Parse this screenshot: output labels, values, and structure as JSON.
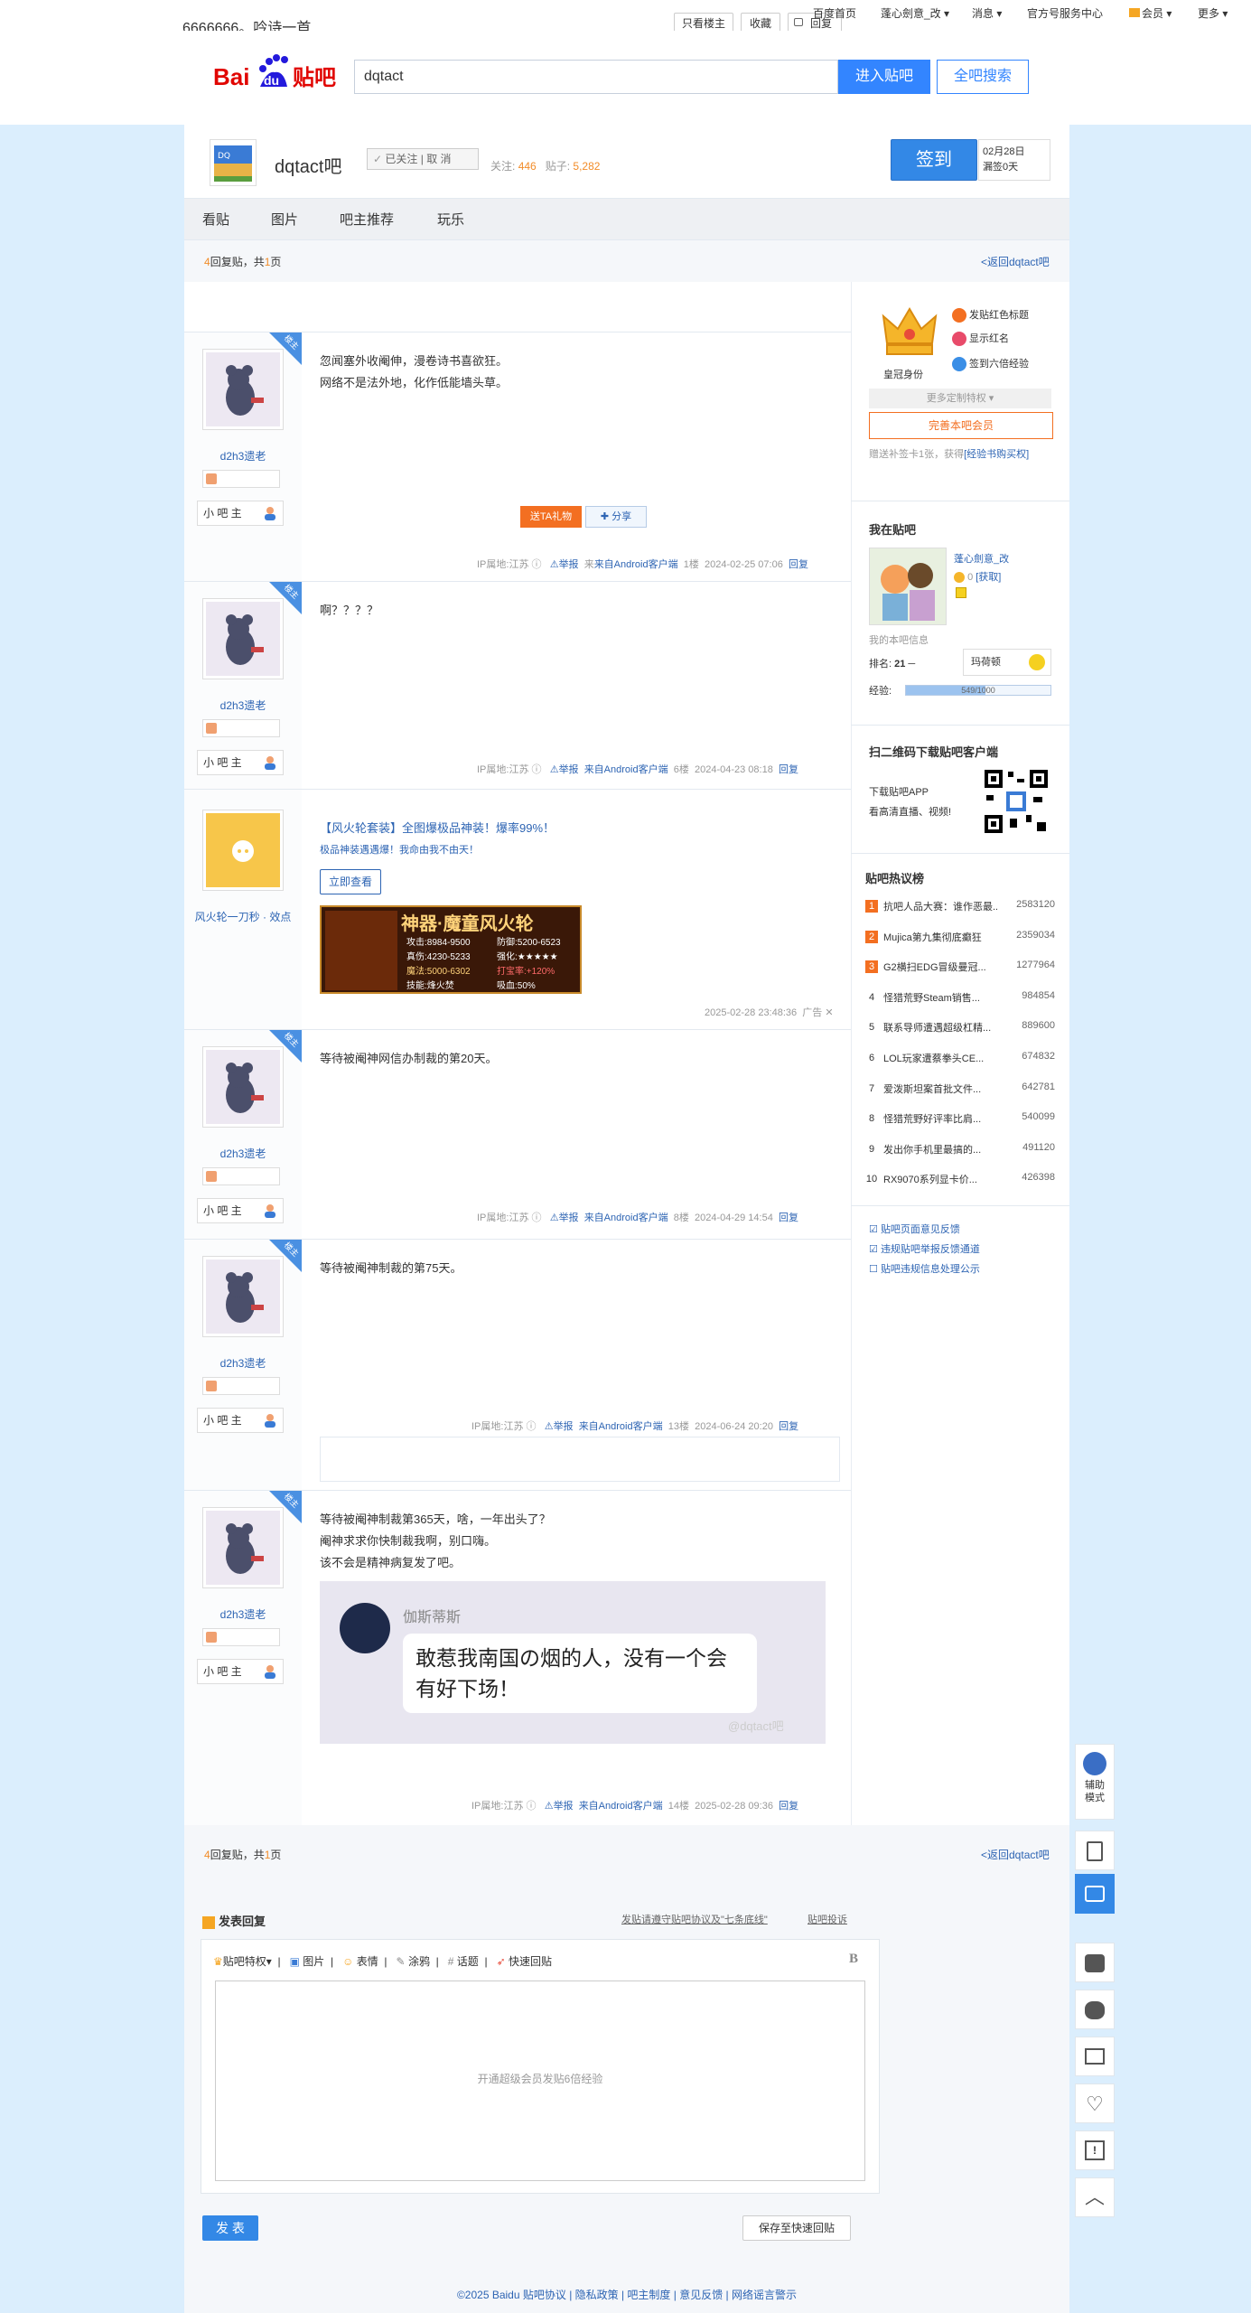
{
  "topbar": {
    "heading": "6666666。吟诗一首",
    "only_lz": "只看楼主",
    "collect": "收藏",
    "reply": "回复",
    "links": [
      "百度首页",
      "蓬心劍意_改",
      "消息",
      "官方号服务中心",
      "会员",
      "更多"
    ]
  },
  "search": {
    "value": "dqtact",
    "enter": "进入贴吧",
    "all": "全吧搜索"
  },
  "forum": {
    "name": "dqtact吧",
    "follow": "已关注",
    "unfollow": "取 消",
    "follow_label": "关注:",
    "follow_count": "446",
    "posts_label": "贴子:",
    "posts_count": "5,282",
    "signin": "签到",
    "date": "02月28日",
    "streak": "漏签0天"
  },
  "nav": [
    "看贴",
    "图片",
    "吧主推荐",
    "玩乐"
  ],
  "pager": {
    "count": "4",
    "text_a": "回复贴，共",
    "pages": "1",
    "text_b": "页",
    "back": "<返回dqtact吧"
  },
  "posts": [
    {
      "author": "d2h3遗老",
      "role": "小 吧 主",
      "lines": [
        "忽闻塞外收阉伸，漫卷诗书喜欲狂。",
        "网络不是法外地，化作低能墙头草。"
      ],
      "gift": "送TA礼物",
      "share": "分享",
      "ip": "IP属地:江苏",
      "report": "举报",
      "client": "来自Android客户端",
      "floor": "1楼",
      "time": "2024-02-25 07:06",
      "reply": "回复"
    },
    {
      "author": "d2h3遗老",
      "role": "小 吧 主",
      "lines": [
        "啊？？？？"
      ],
      "ip": "IP属地:江苏",
      "report": "举报",
      "client": "来自Android客户端",
      "floor": "6楼",
      "time": "2024-04-23 08:18",
      "reply": "回复"
    },
    {
      "author": "d2h3遗老",
      "role": "小 吧 主",
      "lines": [
        "等待被阉神网信办制裁的第20天。"
      ],
      "ip": "IP属地:江苏",
      "report": "举报",
      "client": "来自Android客户端",
      "floor": "8楼",
      "time": "2024-04-29 14:54",
      "reply": "回复"
    },
    {
      "author": "d2h3遗老",
      "role": "小 吧 主",
      "lines": [
        "等待被阉神制裁的第75天。"
      ],
      "ip": "IP属地:江苏",
      "report": "举报",
      "client": "来自Android客户端",
      "floor": "13楼",
      "time": "2024-06-24 20:20",
      "reply": "回复"
    },
    {
      "author": "d2h3遗老",
      "role": "小 吧 主",
      "lines": [
        "等待被阉神制裁第365天，啥，一年出头了？",
        "阉神求求你快制裁我啊，别口嗨。",
        "该不会是精神病复发了吧。"
      ],
      "img_name": "伽斯蒂斯",
      "img_bubble": "敢惹我南国の烟的人，没有一个会有好下场！",
      "img_watermark": "@dqtact吧",
      "ip": "IP属地:江苏",
      "report": "举报",
      "client": "来自Android客户端",
      "floor": "14楼",
      "time": "2025-02-28 09:36",
      "reply": "回复"
    }
  ],
  "ad": {
    "author": "风火轮一刀秒 · 效点",
    "title": "【风火轮套装】全图爆极品神装！爆率99%！",
    "sub": "极品神装遇遇爆！我命由我不由天！",
    "btn": "立即查看",
    "banner_title": "神器·魔童风火轮",
    "stats": [
      "攻击:8984-9500",
      "防御:5200-6523",
      "真伤:4230-5233",
      "强化:★★★★★",
      "魔法:5000-6302",
      "打宝率:+120%",
      "技能:烽火焚",
      "吸血:50%"
    ],
    "time": "2025-02-28 23:48:36",
    "label": "广告"
  },
  "sidebar": {
    "vip": {
      "title": "皇冠身份",
      "perks": [
        "发贴红色标题",
        "显示红名",
        "签到六倍经验"
      ],
      "more": "更多定制特权",
      "upgrade": "完善本吧会员",
      "note": "赠送补签卡1张，获得",
      "note_link": "[经验书购买权]"
    },
    "mine": {
      "title": "我在贴吧",
      "user": "蓬心劍意_改",
      "get": "[获取]",
      "info": "我的本吧信息",
      "rank_label": "排名:",
      "rank": "21",
      "title_badge": "玛荷顿",
      "exp_label": "经验:",
      "exp": "549/1000"
    },
    "app": {
      "title": "扫二维码下载贴吧客户端",
      "line1": "下载贴吧APP",
      "line2": "看高清直播、视频!"
    },
    "hot": {
      "title": "贴吧热议榜",
      "items": [
        {
          "rank": "1",
          "title": "抗吧人品大赛：谁作恶最...",
          "count": "2583120"
        },
        {
          "rank": "2",
          "title": "Mujica第九集彻底癫狂",
          "count": "2359034"
        },
        {
          "rank": "3",
          "title": "G2横扫EDG冒级曼冠...",
          "count": "1277964"
        },
        {
          "rank": "4",
          "title": "怪猎荒野Steam销售...",
          "count": "984854"
        },
        {
          "rank": "5",
          "title": "联系导师遭遇超级杠精...",
          "count": "889600"
        },
        {
          "rank": "6",
          "title": "LOL玩家遭蔡拳头CE...",
          "count": "674832"
        },
        {
          "rank": "7",
          "title": "爱泼斯坦案首批文件...",
          "count": "642781"
        },
        {
          "rank": "8",
          "title": "怪猎荒野好评率比肩...",
          "count": "540099"
        },
        {
          "rank": "9",
          "title": "发出你手机里最搞的...",
          "count": "491120"
        },
        {
          "rank": "10",
          "title": "RX9070系列显卡价...",
          "count": "426398"
        }
      ]
    },
    "links": [
      "贴吧页面意见反馈",
      "违规贴吧举报反馈通道",
      "贴吧违规信息处理公示"
    ]
  },
  "editor": {
    "title": "发表回复",
    "notice": "发贴请遵守贴吧协议及\"七条底线\"",
    "complaint": "贴吧投诉",
    "tools": [
      "贴吧特权",
      "图片",
      "表情",
      "涂鸦",
      "话题",
      "快速回贴"
    ],
    "bold": "B",
    "placeholder": "开通超级会员发贴6倍经验",
    "publish": "发 表",
    "save": "保存至快速回贴"
  },
  "footer": "©2025 Baidu 贴吧协议 | 隐私政策 | 吧主制度 | 意见反馈 | 网络谣言警示",
  "float": {
    "assist": "辅助模式"
  }
}
